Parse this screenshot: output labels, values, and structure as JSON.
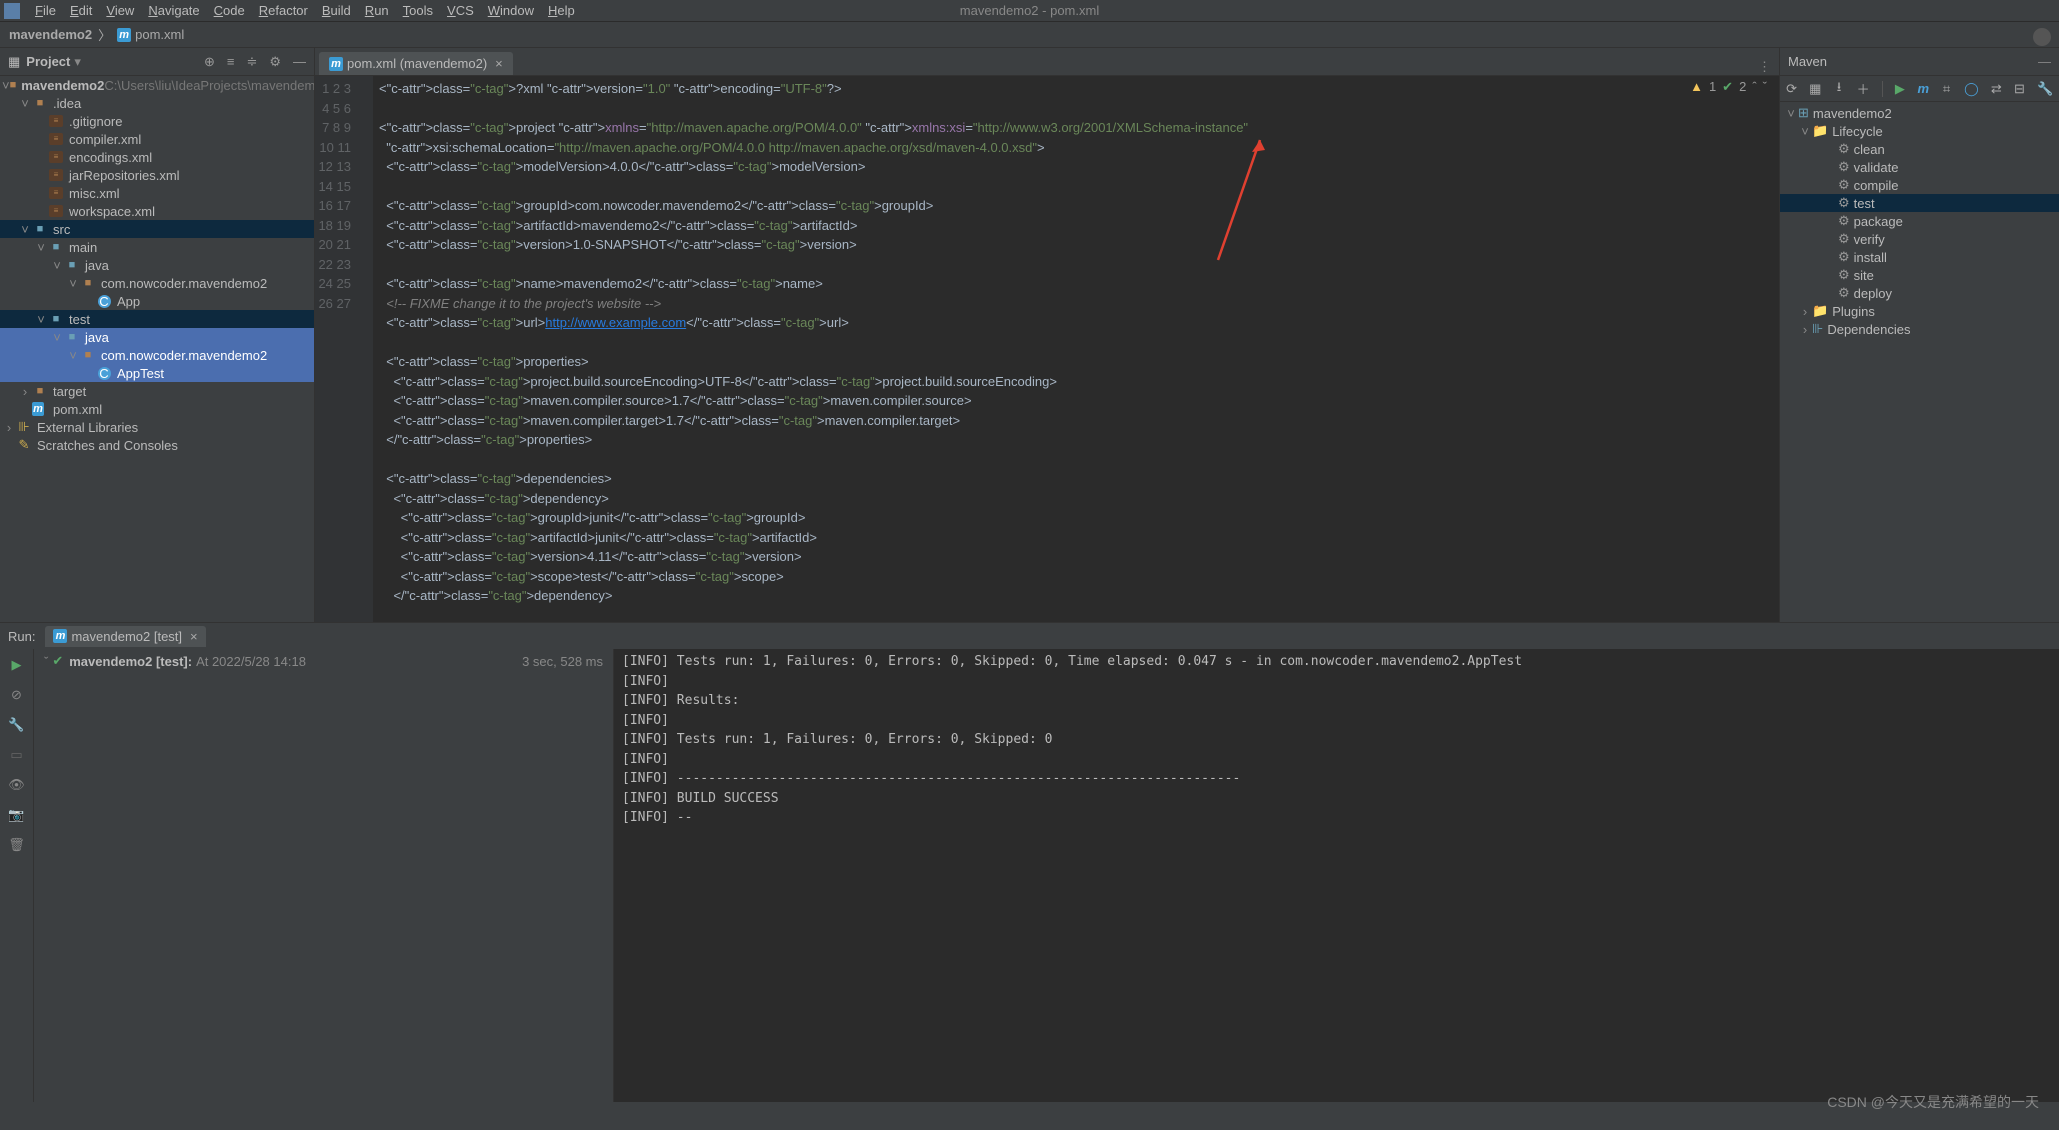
{
  "window_title": "mavendemo2 - pom.xml",
  "menu": [
    "File",
    "Edit",
    "View",
    "Navigate",
    "Code",
    "Refactor",
    "Build",
    "Run",
    "Tools",
    "VCS",
    "Window",
    "Help"
  ],
  "breadcrumb": {
    "root": "mavendemo2",
    "file": "pom.xml"
  },
  "project_panel": {
    "title": "Project"
  },
  "project_root": {
    "name": "mavendemo2",
    "path": "C:\\Users\\liu\\IdeaProjects\\mavendemo"
  },
  "project_tree_flat": [
    {
      "d": 1,
      "tw": "v",
      "ic": "fold-brown",
      "t": ".idea"
    },
    {
      "d": 2,
      "tw": "",
      "ic": "file-xml",
      "t": ".gitignore"
    },
    {
      "d": 2,
      "tw": "",
      "ic": "file-xml",
      "t": "compiler.xml"
    },
    {
      "d": 2,
      "tw": "",
      "ic": "file-xml",
      "t": "encodings.xml"
    },
    {
      "d": 2,
      "tw": "",
      "ic": "file-xml",
      "t": "jarRepositories.xml"
    },
    {
      "d": 2,
      "tw": "",
      "ic": "file-xml",
      "t": "misc.xml"
    },
    {
      "d": 2,
      "tw": "",
      "ic": "file-xml",
      "t": "workspace.xml"
    },
    {
      "d": 1,
      "tw": "v",
      "ic": "fold-blue",
      "t": "src",
      "sel": true
    },
    {
      "d": 2,
      "tw": "v",
      "ic": "fold-blue",
      "t": "main"
    },
    {
      "d": 3,
      "tw": "v",
      "ic": "fold-blue",
      "t": "java"
    },
    {
      "d": 4,
      "tw": "v",
      "ic": "fold-brown",
      "t": "com.nowcoder.mavendemo2"
    },
    {
      "d": 5,
      "tw": "",
      "ic": "file-c",
      "t": "App"
    },
    {
      "d": 2,
      "tw": "v",
      "ic": "fold-blue",
      "t": "test",
      "sel": true
    },
    {
      "d": 3,
      "tw": "v",
      "ic": "fold-blue",
      "t": "java",
      "hl": true
    },
    {
      "d": 4,
      "tw": "v",
      "ic": "fold-brown",
      "t": "com.nowcoder.mavendemo2",
      "hl": true
    },
    {
      "d": 5,
      "tw": "",
      "ic": "file-c",
      "t": "AppTest",
      "hl": true
    },
    {
      "d": 1,
      "tw": ">",
      "ic": "fold-brown",
      "t": "target"
    },
    {
      "d": 1,
      "tw": "",
      "ic": "m-icon",
      "t": "pom.xml"
    }
  ],
  "external_libs": "External Libraries",
  "scratches": "Scratches and Consoles",
  "editor_tab": {
    "label": "pom.xml (mavendemo2)"
  },
  "hints": {
    "warn": "1",
    "ok": "2"
  },
  "code_lines": [
    "<?xml version=\"1.0\" encoding=\"UTF-8\"?>",
    "",
    "<project xmlns=\"http://maven.apache.org/POM/4.0.0\" xmlns:xsi=\"http://www.w3.org/2001/XMLSchema-instance\"",
    "  xsi:schemaLocation=\"http://maven.apache.org/POM/4.0.0 http://maven.apache.org/xsd/maven-4.0.0.xsd\">",
    "  <modelVersion>4.0.0</modelVersion>",
    "",
    "  <groupId>com.nowcoder.mavendemo2</groupId>",
    "  <artifactId>mavendemo2</artifactId>",
    "  <version>1.0-SNAPSHOT</version>",
    "",
    "  <name>mavendemo2</name>",
    "  <!-- FIXME change it to the project's website -->",
    "  <url>http://www.example.com</url>",
    "",
    "  <properties>",
    "    <project.build.sourceEncoding>UTF-8</project.build.sourceEncoding>",
    "    <maven.compiler.source>1.7</maven.compiler.source>",
    "    <maven.compiler.target>1.7</maven.compiler.target>",
    "  </properties>",
    "",
    "  <dependencies>",
    "    <dependency>",
    "      <groupId>junit</groupId>",
    "      <artifactId>junit</artifactId>",
    "      <version>4.11</version>",
    "      <scope>test</scope>",
    "    </dependency>"
  ],
  "maven": {
    "title": "Maven",
    "root": "mavendemo2",
    "lifecycle_label": "Lifecycle",
    "goals": [
      "clean",
      "validate",
      "compile",
      "test",
      "package",
      "verify",
      "install",
      "site",
      "deploy"
    ],
    "sel_goal": "test",
    "plugins": "Plugins",
    "deps": "Dependencies"
  },
  "run": {
    "label": "Run:",
    "tab": "mavendemo2 [test]",
    "tree_line": "mavendemo2 [test]:",
    "tree_time": "At 2022/5/28 14:18",
    "duration": "3 sec, 528 ms",
    "output": [
      "[INFO] Tests run: 1, Failures: 0, Errors: 0, Skipped: 0, Time elapsed: 0.047 s - in com.nowcoder.mavendemo2.AppTest",
      "[INFO]",
      "[INFO] Results:",
      "[INFO]",
      "[INFO] Tests run: 1, Failures: 0, Errors: 0, Skipped: 0",
      "[INFO]",
      "[INFO] ------------------------------------------------------------------------",
      "[INFO] BUILD SUCCESS",
      "[INFO] --"
    ]
  },
  "watermark": "CSDN @今天又是充满希望的一天"
}
